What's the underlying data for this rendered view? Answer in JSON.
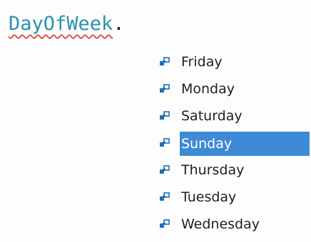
{
  "editor": {
    "type_name": "DayOfWeek",
    "member_access": "."
  },
  "completion": {
    "icon": "enum-member-icon",
    "icon_color": "#1f6fb8",
    "selected_background": "#3f8ad6",
    "selected_text_color": "#ffffff",
    "selected_label": "Sunday",
    "items": [
      {
        "label": "Friday"
      },
      {
        "label": "Monday"
      },
      {
        "label": "Saturday"
      },
      {
        "label": "Sunday"
      },
      {
        "label": "Thursday"
      },
      {
        "label": "Tuesday"
      },
      {
        "label": "Wednesday"
      }
    ]
  }
}
